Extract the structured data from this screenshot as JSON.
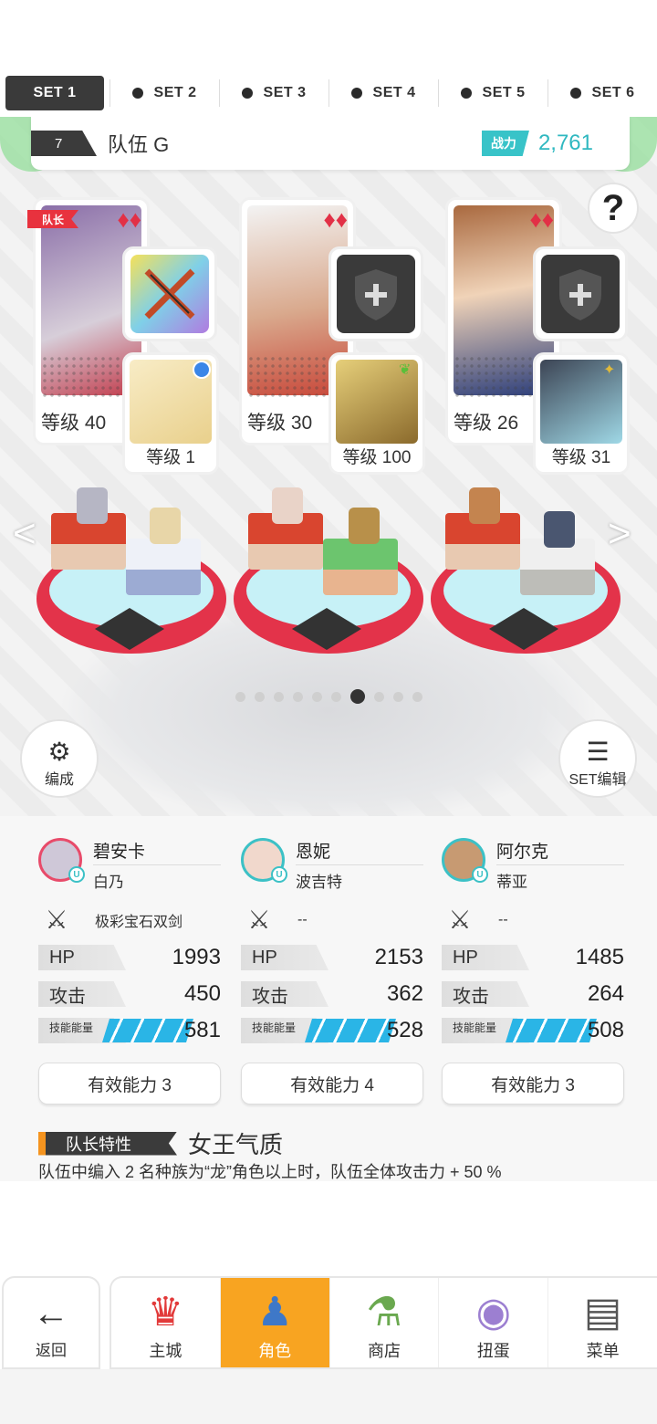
{
  "set_tabs": [
    {
      "label": "SET 1",
      "active": true
    },
    {
      "label": "SET 2",
      "active": false
    },
    {
      "label": "SET 3",
      "active": false
    },
    {
      "label": "SET 4",
      "active": false
    },
    {
      "label": "SET 5",
      "active": false
    },
    {
      "label": "SET 6",
      "active": false
    }
  ],
  "team": {
    "number": "7",
    "name": "队伍 G",
    "power_label": "战力",
    "power_value": "2,761"
  },
  "help_icon": "?",
  "leader_tag": "队长",
  "characters": [
    {
      "level": "等级 40",
      "suit": "♦♦",
      "sub_level": "等级 1",
      "portrait_color": "#b9a9c9",
      "sub_color": "#f6e4b0",
      "sub_badge": "blue-dot"
    },
    {
      "level": "等级 30",
      "suit": "♦♦",
      "sub_level": "等级 100",
      "portrait_color": "#f0d3c5",
      "sub_color": "#c8a63c",
      "sub_badge": "leaf"
    },
    {
      "level": "等级 26",
      "suit": "♦♦",
      "sub_level": "等级 31",
      "portrait_color": "#c79a72",
      "sub_color": "#5d6e86",
      "sub_badge": "sparkle"
    }
  ],
  "arrows": {
    "left": "<",
    "right": ">"
  },
  "page_dots": {
    "count": 10,
    "active_index": 6
  },
  "buttons": {
    "formation": "编成",
    "set_edit": "SET编辑"
  },
  "members": [
    {
      "name": "碧安卡",
      "sub_name": "白乃",
      "weapon": "极彩宝石双剑",
      "hp_label": "HP",
      "hp": "1993",
      "atk_label": "攻击",
      "atk": "450",
      "energy_label": "技能能量",
      "energy": "581",
      "ability": "有效能力 3",
      "avatar_color": "#cfc8d8",
      "ring": "#e84b6a"
    },
    {
      "name": "恩妮",
      "sub_name": "波吉特",
      "weapon": "--",
      "hp_label": "HP",
      "hp": "2153",
      "atk_label": "攻击",
      "atk": "362",
      "energy_label": "技能能量",
      "energy": "528",
      "ability": "有效能力 4",
      "avatar_color": "#f1d8cc",
      "ring": "#3cc1c6"
    },
    {
      "name": "阿尔克",
      "sub_name": "蒂亚",
      "weapon": "--",
      "hp_label": "HP",
      "hp": "1485",
      "atk_label": "攻击",
      "atk": "264",
      "energy_label": "技能能量",
      "energy": "508",
      "ability": "有效能力 3",
      "avatar_color": "#c79a72",
      "ring": "#3cc1c6"
    }
  ],
  "leader_trait": {
    "label": "队长特性",
    "name": "女王气质",
    "description": "队伍中编入 2 名种族为“龙”角色以上时，队伍全体攻击力 + 50 %"
  },
  "nav": {
    "back": "返回",
    "tabs": [
      {
        "label": "主城",
        "icon": "castle-icon",
        "active": false
      },
      {
        "label": "角色",
        "icon": "character-icon",
        "active": true
      },
      {
        "label": "商店",
        "icon": "shop-icon",
        "active": false
      },
      {
        "label": "扭蛋",
        "icon": "gacha-icon",
        "active": false
      },
      {
        "label": "菜单",
        "icon": "menu-icon",
        "active": false
      }
    ]
  }
}
